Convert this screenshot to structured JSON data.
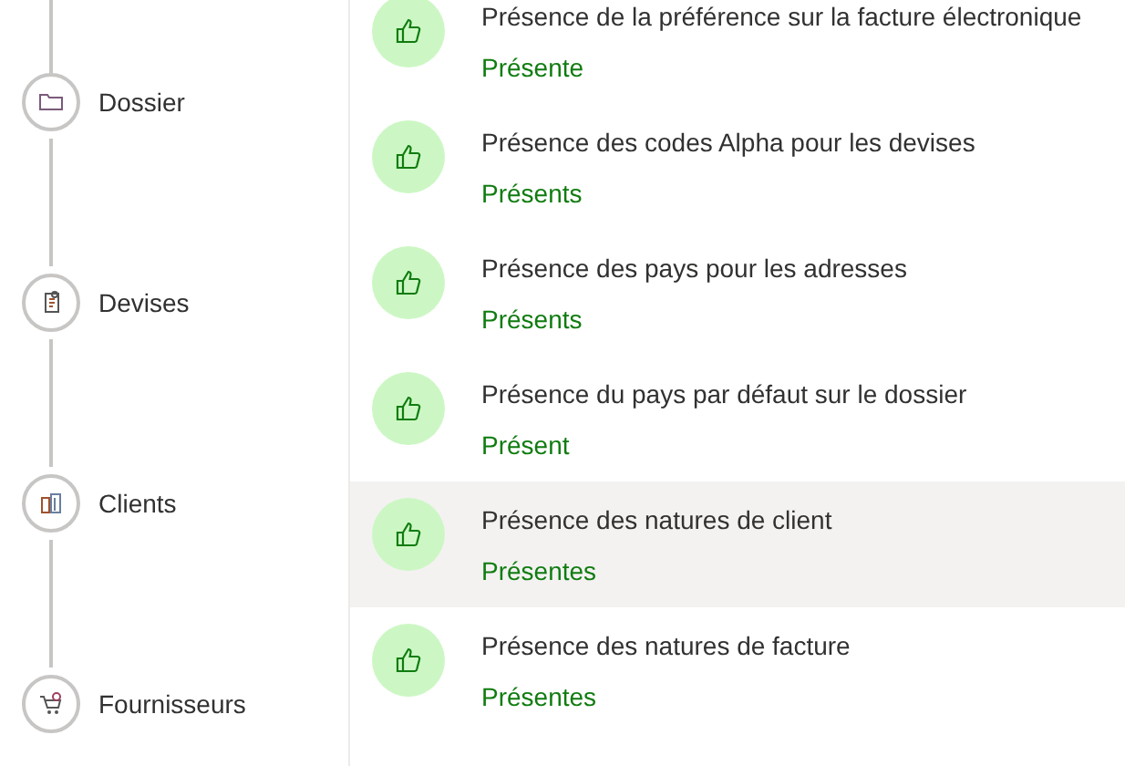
{
  "steps": [
    {
      "label": "Dossier",
      "kind": "folder"
    },
    {
      "label": "Devises",
      "kind": "document"
    },
    {
      "label": "Clients",
      "kind": "buildings"
    },
    {
      "label": "Fournisseurs",
      "kind": "cart"
    }
  ],
  "checks": [
    {
      "title": "Présence de la préférence sur la facture électronique",
      "status": "Présente",
      "selected": false
    },
    {
      "title": "Présence des codes Alpha pour les devises",
      "status": "Présents",
      "selected": false
    },
    {
      "title": "Présence des pays pour les adresses",
      "status": "Présents",
      "selected": false
    },
    {
      "title": "Présence du pays par défaut sur le dossier",
      "status": "Présent",
      "selected": false
    },
    {
      "title": "Présence des natures de client",
      "status": "Présentes",
      "selected": true
    },
    {
      "title": "Présence des natures de facture",
      "status": "Présentes",
      "selected": false
    }
  ]
}
